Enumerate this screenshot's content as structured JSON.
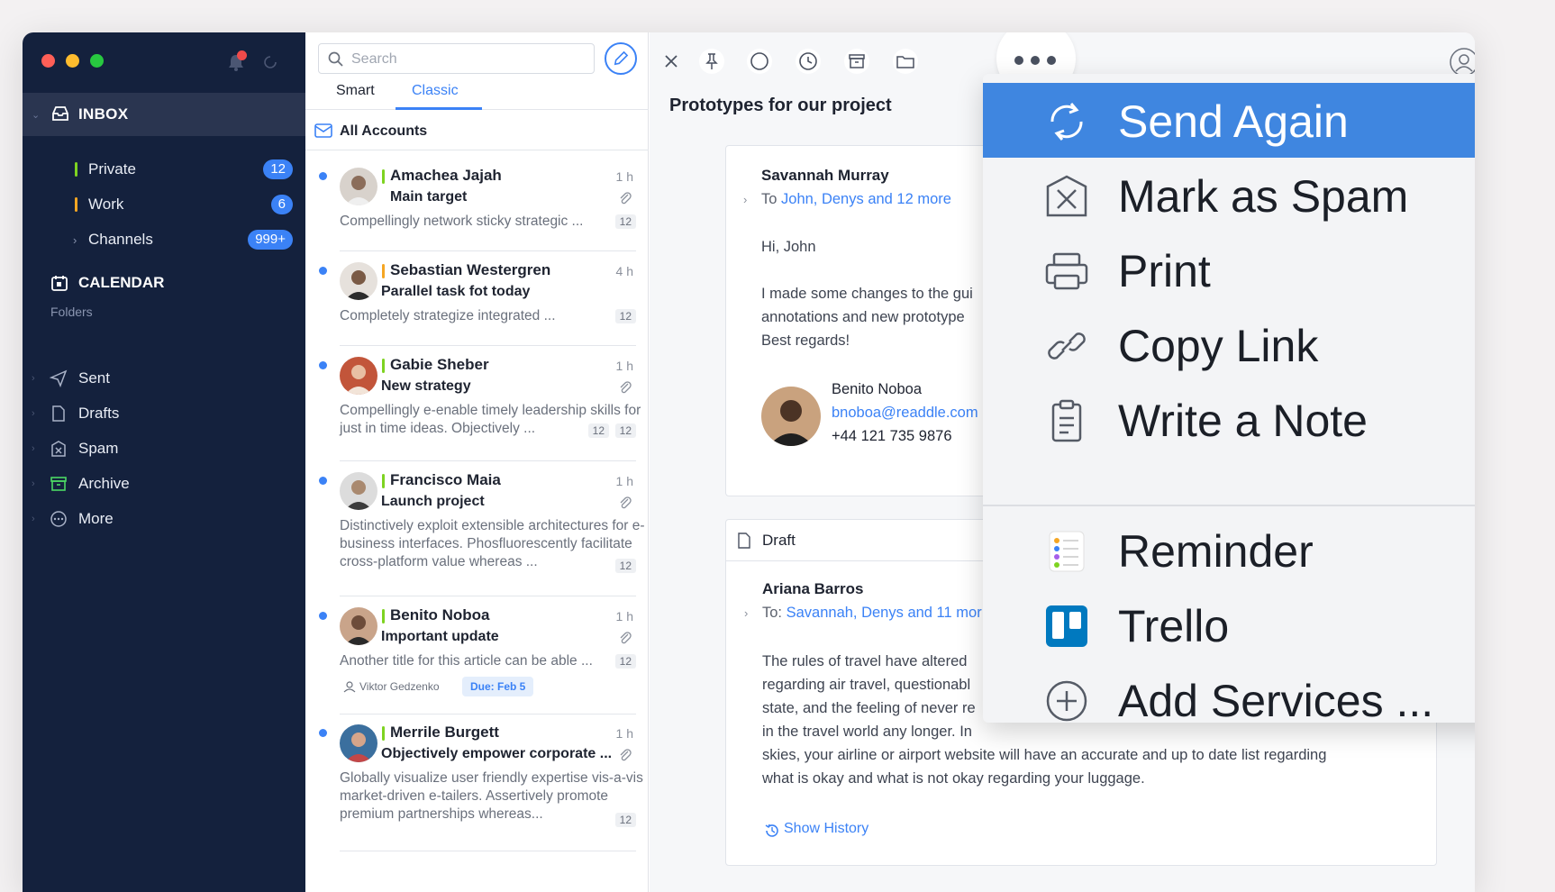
{
  "sidebar": {
    "inbox_label": "INBOX",
    "accounts": [
      {
        "label": "Private",
        "badge": "12",
        "color": "#7ed321"
      },
      {
        "label": "Work",
        "badge": "6",
        "color": "#f5a623"
      },
      {
        "label": "Channels",
        "badge": "999+"
      }
    ],
    "calendar_label": "CALENDAR",
    "folders_header": "Folders",
    "folders": [
      {
        "label": "Sent",
        "icon": "send-icon"
      },
      {
        "label": "Drafts",
        "icon": "draft-icon"
      },
      {
        "label": "Spam",
        "icon": "spam-icon"
      },
      {
        "label": "Archive",
        "icon": "archive-icon"
      },
      {
        "label": "More",
        "icon": "more-icon"
      }
    ]
  },
  "list": {
    "search_placeholder": "Search",
    "tabs": [
      "Smart",
      "Classic"
    ],
    "active_tab": "Classic",
    "all_accounts_label": "All Accounts",
    "messages": [
      {
        "sender": "Amachea Jajah",
        "time": "1 h",
        "subject": "Main target",
        "preview": "Compellingly network sticky strategic ...",
        "count": "12",
        "flag": "#7ed321"
      },
      {
        "sender": "Sebastian Westergren",
        "time": "4 h",
        "subject": "Parallel task fot today",
        "preview": "Completely strategize integrated ...",
        "count": "12",
        "flag": "#f5a623"
      },
      {
        "sender": "Gabie Sheber",
        "time": "1 h",
        "subject": "New strategy",
        "preview": "Compellingly e-enable timely leadership skills for just in time ideas. Objectively ...",
        "count": "12",
        "count2": "12",
        "flag": "#7ed321"
      },
      {
        "sender": "Francisco Maia",
        "time": "1 h",
        "subject": "Launch project",
        "preview": "Distinctively exploit extensible architectures for e-business interfaces. Phosfluorescently facilitate cross-platform value whereas ...",
        "count": "12",
        "flag": "#7ed321"
      },
      {
        "sender": "Benito Noboa",
        "time": "1 h",
        "subject": "Important update",
        "preview": "Another title for this article can be able ...",
        "count": "12",
        "assignee": "Viktor Gedzenko",
        "due": "Due: Feb 5",
        "flag": "#7ed321"
      },
      {
        "sender": "Merrile Burgett",
        "time": "1 h",
        "subject": "Objectively empower corporate ...",
        "preview": "Globally visualize user friendly expertise vis-a-vis market-driven e-tailers. Assertively promote premium partnerships whereas...",
        "count": "12",
        "flag": "#7ed321"
      }
    ]
  },
  "reader": {
    "thread_title": "Prototypes for our project",
    "email1": {
      "from": "Savannah Murray",
      "to_prefix": "To ",
      "to_names": "John, Denys and 12 more",
      "greeting": "Hi, John",
      "body_line1": "I made some changes to the gui",
      "body_line2": "annotations and new prototype",
      "body_line3": "Best regards!",
      "sig_name": "Benito Noboa",
      "sig_email": "bnoboa@readdle.com",
      "sig_phone": "+44 121 735 9876"
    },
    "draft": {
      "label": "Draft",
      "from": "Ariana Barros",
      "to_prefix": "To: ",
      "to_names": "Savannah, Denys and 11 mor",
      "body_line1": "The rules of travel have altered",
      "body_line2": "regarding air travel, questionabl",
      "body_line3": "state, and the feeling of never re",
      "body_line4": "in the travel world any longer. In",
      "body_line5": "skies, your airline or airport website will have an accurate and up to date list regarding",
      "body_line6": "what is okay and what is not okay regarding your luggage.",
      "show_history": "Show History"
    }
  },
  "menu": {
    "items": [
      {
        "label": "Send Again",
        "icon": "send-again-icon",
        "active": true
      },
      {
        "label": "Mark as Spam",
        "icon": "spam-icon"
      },
      {
        "label": "Print",
        "icon": "print-icon"
      },
      {
        "label": "Copy Link",
        "icon": "link-icon"
      },
      {
        "label": "Write a Note",
        "icon": "note-icon"
      }
    ],
    "services": [
      {
        "label": "Reminder",
        "icon": "reminders-icon"
      },
      {
        "label": "Trello",
        "icon": "trello-icon"
      },
      {
        "label": "Add Services ...",
        "icon": "add-circle-icon"
      }
    ]
  },
  "colors": {
    "accent": "#3b82f6",
    "sidebar_bg": "#14213d",
    "menu_highlight": "#3f86e0"
  }
}
